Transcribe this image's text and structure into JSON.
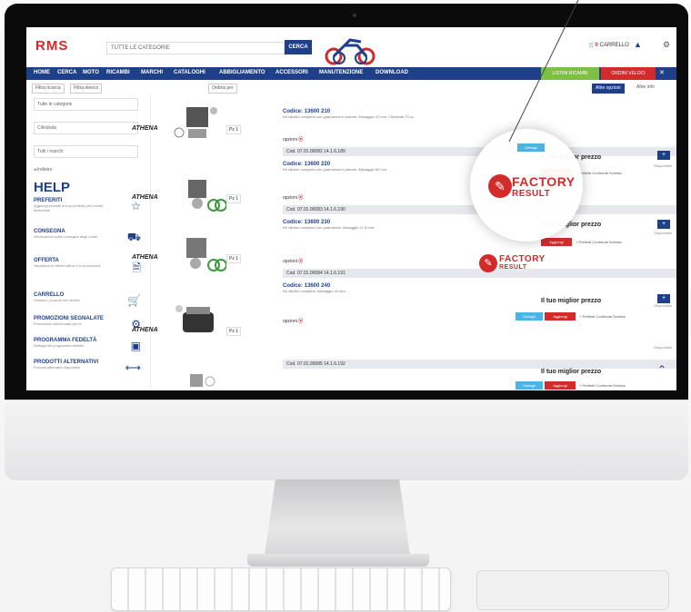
{
  "header": {
    "logo_main": "RMS",
    "search_placeholder": "TUTTE LE CATEGORIE",
    "search_button": "CERCA",
    "cart_label": "CARRELLO",
    "cart_count": "0"
  },
  "nav": {
    "items": [
      "HOME",
      "CERCA",
      "MOTO",
      "RICAMBI",
      "MARCHI",
      "CATALOGHI",
      "ABBIGLIAMENTO",
      "ACCESSORI",
      "MANUTENZIONE",
      "DOWNLOAD"
    ],
    "green_button": "LISTINI RICAMBI",
    "red_button": "ORDINI VELOCI",
    "close": "✕"
  },
  "filters": {
    "chips": [
      "Filtra ricerca",
      "Filtra elenco"
    ],
    "sort_label": "Ordina per",
    "right_chip": "Altre opzioni",
    "right_link": "Altre info"
  },
  "sidebar": {
    "selects": [
      "Tutte le categorie",
      "Cilindrata",
      "Tutti i marchi"
    ],
    "back_link": "◂ Indietro",
    "help_title": "HELP",
    "items": [
      {
        "title": "PREFERITI",
        "desc": "Aggiungi prodotti ai tuoi preferiti per trovarli facilmente",
        "icon": "star-icon"
      },
      {
        "title": "CONSEGNA",
        "desc": "Informazioni sulla consegna degli ordini",
        "icon": "truck-icon"
      },
      {
        "title": "OFFERTA",
        "desc": "Visualizza le offerte attive e le promozioni",
        "icon": "document-icon"
      },
      {
        "title": "CARRELLO",
        "desc": "Gestisci i prodotti nel carrello",
        "icon": "cart-icon"
      },
      {
        "title": "PROMOZIONI SEGNALATE",
        "desc": "Promozioni selezionate per te",
        "icon": "gears-icon"
      },
      {
        "title": "PROGRAMMA FEDELTÀ",
        "desc": "Dettagli del programma fedeltà",
        "icon": "card-icon"
      },
      {
        "title": "PRODOTTI ALTERNATIVI",
        "desc": "Prodotti alternativi disponibili",
        "icon": "arrows-icon"
      }
    ]
  },
  "products": [
    {
      "brand": "ATHENA",
      "code": "Codice: 13600 210",
      "desc": "Kit cilindro completo con guarnizioni e pistone. Alesaggio 47 mm. Cilindrata 70 cc.",
      "options": "opzioni",
      "qty": "Pz 1",
      "strip": "Cod. 07.01.00082 14.1.6.189",
      "price_title": "Il tuo miglior prezzo",
      "availability": "Disponibile",
      "btn_cyan": "Dettagli",
      "btn_red": "Aggiungi",
      "links": "+ Preferiti  Confronta  Scheda"
    },
    {
      "brand": "ATHENA",
      "code": "Codice: 13600 220",
      "desc": "Kit cilindro completo con guarnizioni e pistone. Alesaggio 50 mm.",
      "options": "opzioni",
      "qty": "Pz 1",
      "strip": "Cod. 07.01.00083 14.1.6.190",
      "price_title": "Il tuo miglior prezzo",
      "availability": "Disponibile",
      "btn_cyan": "Dettagli",
      "btn_red": "Aggiungi",
      "links": "+ Preferiti  Confronta  Scheda"
    },
    {
      "brand": "ATHENA",
      "code": "Codice: 13600 230",
      "desc": "Kit cilindro completo con guarnizioni. Alesaggio 47,6 mm.",
      "options": "opzioni",
      "qty": "Pz 1",
      "strip": "Cod. 07.01.00084 14.1.6.191",
      "price_title": "Il tuo miglior prezzo",
      "availability": "Disponibile",
      "btn_cyan": "Dettagli",
      "btn_red": "Aggiungi",
      "links": "+ Preferiti  Confronta  Scheda"
    },
    {
      "brand": "ATHENA",
      "code": "Codice: 13600 240",
      "desc": "Kit cilindro completo. Alesaggio 40 mm.",
      "options": "opzioni",
      "qty": "Pz 1",
      "strip": "Cod. 07.01.00085 14.1.6.192",
      "price_title": "Il tuo miglior prezzo",
      "availability": "Disponibile",
      "btn_cyan": "Dettagli",
      "btn_red": "Aggiungi",
      "links": "+ Preferiti  Confronta  Scheda"
    }
  ],
  "factory_badge": {
    "line1": "FACTORY",
    "line2": "RESULT"
  },
  "colors": {
    "brand_blue": "#1e3f8a",
    "accent_red": "#d32a2a",
    "green": "#7dc142",
    "cyan": "#4ab4e4"
  }
}
